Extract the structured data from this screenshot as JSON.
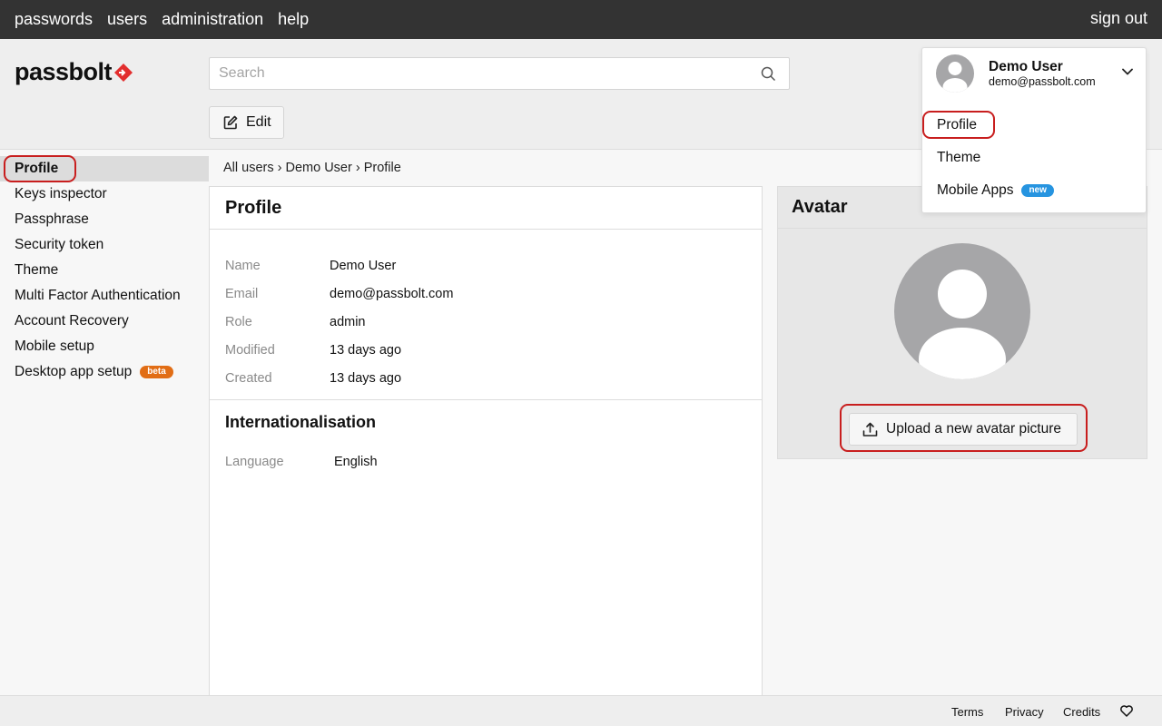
{
  "topnav": {
    "items": [
      "passwords",
      "users",
      "administration",
      "help"
    ],
    "signout": "sign out"
  },
  "brand": {
    "name": "passbolt",
    "accent": "#e22e2e"
  },
  "search": {
    "placeholder": "Search",
    "value": ""
  },
  "toolbar": {
    "edit_label": "Edit"
  },
  "sidebar": {
    "items": [
      {
        "label": "Profile",
        "active": true
      },
      {
        "label": "Keys inspector"
      },
      {
        "label": "Passphrase"
      },
      {
        "label": "Security token"
      },
      {
        "label": "Theme"
      },
      {
        "label": "Multi Factor Authentication"
      },
      {
        "label": "Account Recovery"
      },
      {
        "label": "Mobile setup"
      },
      {
        "label": "Desktop app setup",
        "badge": "beta"
      }
    ]
  },
  "breadcrumb": "All users › Demo User › Profile",
  "profile": {
    "title": "Profile",
    "fields": [
      {
        "key": "Name",
        "value": "Demo User"
      },
      {
        "key": "Email",
        "value": "demo@passbolt.com"
      },
      {
        "key": "Role",
        "value": "admin"
      },
      {
        "key": "Modified",
        "value": "13 days ago"
      },
      {
        "key": "Created",
        "value": "13 days ago"
      }
    ],
    "i18n_title": "Internationalisation",
    "language_key": "Language",
    "language_value": "English"
  },
  "avatar": {
    "title": "Avatar",
    "upload_label": "Upload a new avatar picture"
  },
  "user_menu": {
    "name": "Demo User",
    "email": "demo@passbolt.com",
    "items": [
      "Profile",
      "Theme",
      "Mobile Apps"
    ],
    "mobile_badge": "new"
  },
  "footer": {
    "terms": "Terms",
    "privacy": "Privacy",
    "credits": "Credits",
    "heart_icon": "heart-icon"
  },
  "colors": {
    "topbar": "#333333",
    "highlight": "#c81e1e",
    "beta": "#e16d15",
    "new": "#2694e0"
  }
}
